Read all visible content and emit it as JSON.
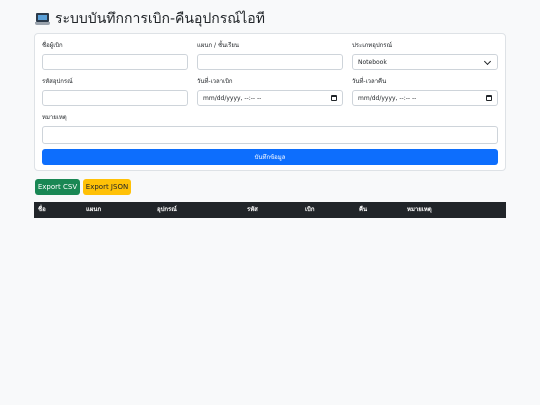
{
  "page": {
    "title": "ระบบบันทึกการเบิก-คืนอุปกรณ์ไอที",
    "title_icon": "laptop-icon"
  },
  "form": {
    "borrower_name_label": "ชื่อผู้เบิก",
    "borrower_name_value": "",
    "department_label": "แผนก / ชั้นเรียน",
    "department_value": "",
    "device_type_label": "ประเภทอุปกรณ์",
    "device_type_value": "Notebook",
    "device_code_label": "รหัสอุปกรณ์",
    "device_code_value": "",
    "borrow_datetime_label": "วันที่-เวลาเบิก",
    "borrow_datetime_placeholder": "mm/dd/yyyy, --:-- --",
    "return_datetime_label": "วันที่-เวลาคืน",
    "return_datetime_placeholder": "mm/dd/yyyy, --:-- --",
    "note_label": "หมายเหตุ",
    "note_value": "",
    "save_button": "บันทึกข้อมูล"
  },
  "export": {
    "csv_button": "Export CSV",
    "json_button": "Export JSON"
  },
  "table": {
    "headers": [
      "ชื่อ",
      "แผนก",
      "อุปกรณ์",
      "รหัส",
      "เบิก",
      "คืน",
      "หมายเหตุ"
    ],
    "rows": []
  },
  "colors": {
    "primary": "#0d6efd",
    "success": "#198754",
    "warning": "#ffc107",
    "dark": "#212529",
    "background": "#f8f9fa"
  }
}
